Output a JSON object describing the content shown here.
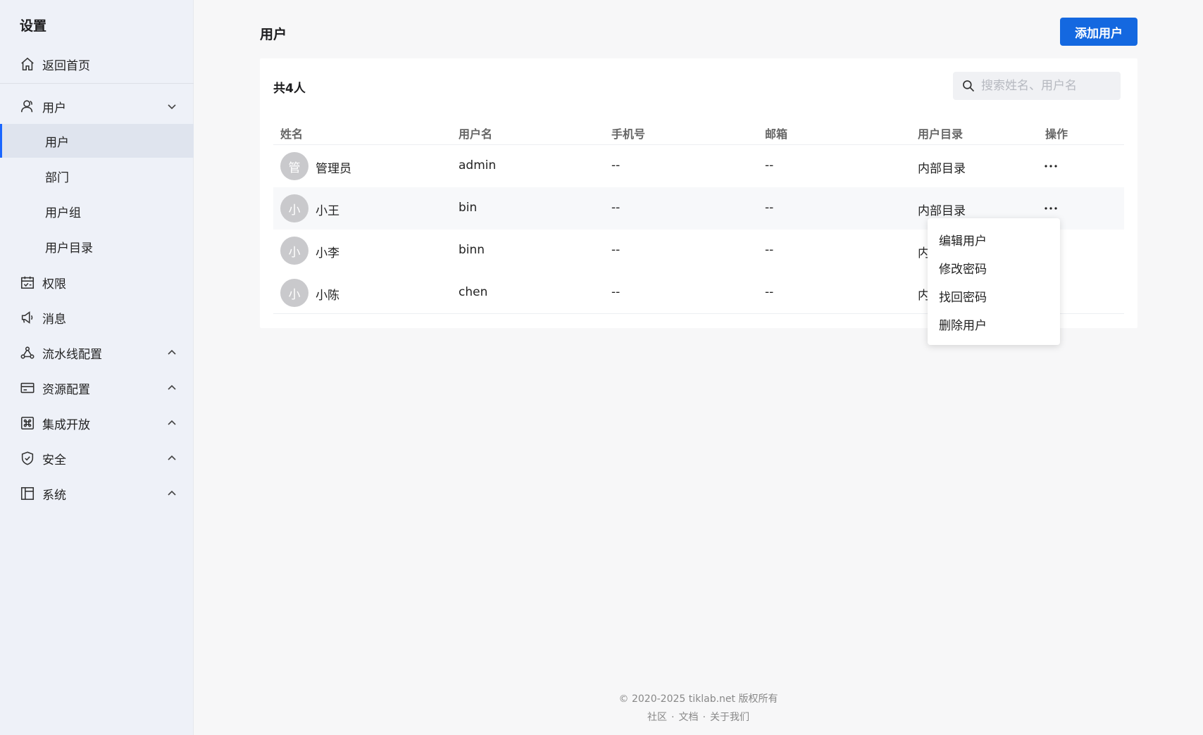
{
  "sidebar": {
    "title": "设置",
    "home": "返回首页",
    "groups": [
      {
        "label": "用户",
        "expanded": true
      },
      {
        "label": "权限"
      },
      {
        "label": "消息"
      },
      {
        "label": "流水线配置"
      },
      {
        "label": "资源配置"
      },
      {
        "label": "集成开放"
      },
      {
        "label": "安全"
      },
      {
        "label": "系统"
      }
    ],
    "user_sub": [
      "用户",
      "部门",
      "用户组",
      "用户目录"
    ],
    "active_sub": "用户"
  },
  "page": {
    "title": "用户",
    "add_button": "添加用户",
    "count": "共4人",
    "search_placeholder": "搜索姓名、用户名"
  },
  "table": {
    "columns": [
      "姓名",
      "用户名",
      "手机号",
      "邮箱",
      "用户目录",
      "操作"
    ],
    "rows": [
      {
        "avatar": "管",
        "name": "管理员",
        "username": "admin",
        "phone": "--",
        "email": "--",
        "directory": "内部目录"
      },
      {
        "avatar": "小",
        "name": "小王",
        "username": "bin",
        "phone": "--",
        "email": "--",
        "directory": "内部目录"
      },
      {
        "avatar": "小",
        "name": "小李",
        "username": "binn",
        "phone": "--",
        "email": "--",
        "directory": "内"
      },
      {
        "avatar": "小",
        "name": "小陈",
        "username": "chen",
        "phone": "--",
        "email": "--",
        "directory": "内"
      }
    ]
  },
  "dropdown": {
    "items": [
      "编辑用户",
      "修改密码",
      "找回密码",
      "删除用户"
    ]
  },
  "footer": {
    "copyright": "© 2020-2025 tiklab.net 版权所有",
    "links": [
      "社区",
      "文档",
      "关于我们"
    ],
    "separator": "·"
  },
  "colors": {
    "primary": "#1468e0",
    "sidebar_bg": "#eef1f8",
    "active_indicator": "#1a66ff"
  }
}
